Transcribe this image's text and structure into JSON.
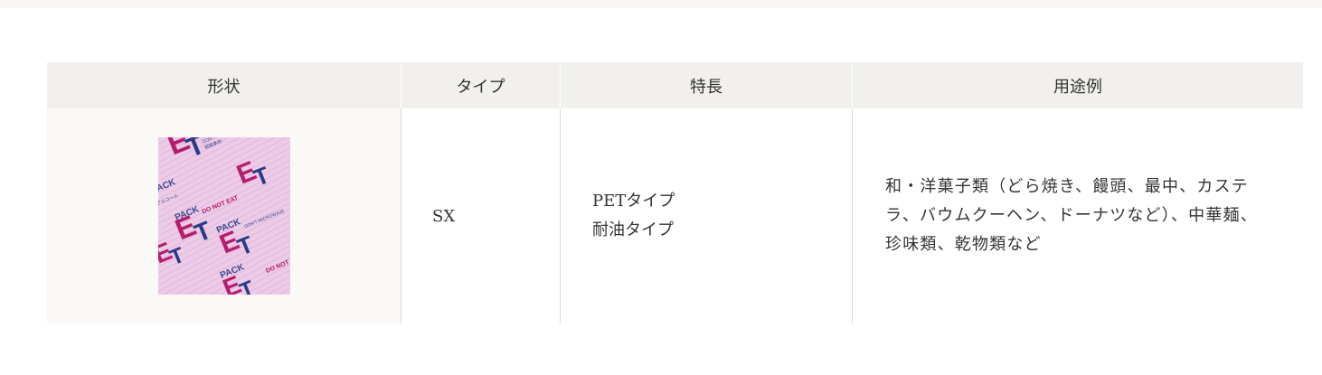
{
  "table": {
    "headers": {
      "shape": "形状",
      "type": "タイプ",
      "features": "特長",
      "usage": "用途例"
    },
    "rows": [
      {
        "shape_image": {
          "icon": "et-pack-sachet-image",
          "brand_text": "PACK",
          "logo_text": "ET",
          "warning_text": "DO NOT EAT",
          "colors": {
            "background": "#ecc9e6",
            "logo": "#b51d6e",
            "logo_dark": "#2a3a86",
            "text": "#3a4a90"
          }
        },
        "type": "SX",
        "features": [
          "PETタイプ",
          "耐油タイプ"
        ],
        "usage": "和・洋菓子類（どら焼き、饅頭、最中、カステラ、バウムクーヘン、ドーナツなど）、中華麺、珍味類、乾物類など"
      }
    ]
  },
  "colors": {
    "header_bg": "#f2f0ec",
    "shape_cell_bg": "#faf9f7",
    "divider": "#d9d9d9",
    "text": "#333333"
  }
}
